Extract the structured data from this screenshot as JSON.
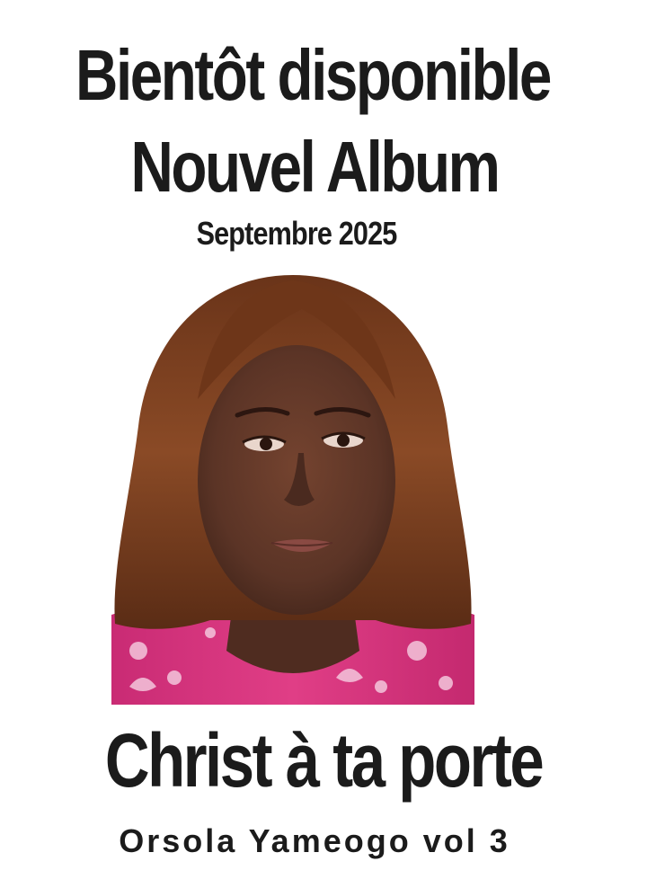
{
  "poster": {
    "headline_line1": "Bientôt disponible",
    "headline_line2": "Nouvel Album",
    "release_date": "Septembre 2025",
    "album_title": "Christ à ta porte",
    "artist_credit": "Orsola Yameogo vol 3"
  },
  "colors": {
    "background": "#ffffff",
    "text": "#1b1b1b",
    "hair": "#7a3f1f",
    "skin": "#5b3426",
    "garment": "#d8357c"
  }
}
